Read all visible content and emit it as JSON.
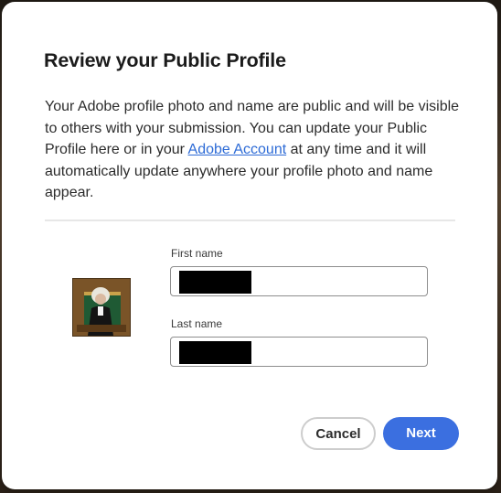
{
  "dialog": {
    "title": "Review your Public Profile",
    "description_before_link": "Your Adobe profile photo and name are public and will be visible to others with your submission. You can update your Public Profile here or in your ",
    "link_label": "Adobe Account",
    "description_after_link": " at any time and it will automatically update anywhere your profile photo and name appear."
  },
  "form": {
    "first_name_label": "First name",
    "first_name_value": "",
    "last_name_label": "Last name",
    "last_name_value": ""
  },
  "buttons": {
    "cancel_label": "Cancel",
    "next_label": "Next"
  },
  "colors": {
    "primary": "#3b6fe0",
    "link": "#2d6bd6"
  }
}
